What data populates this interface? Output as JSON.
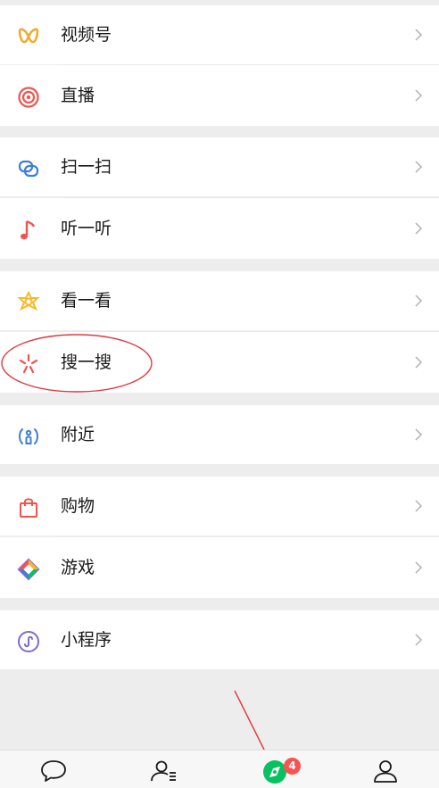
{
  "menu": {
    "channels": {
      "label": "视频号",
      "icon": "channels-icon"
    },
    "live": {
      "label": "直播",
      "icon": "live-icon"
    },
    "scan": {
      "label": "扫一扫",
      "icon": "scan-icon"
    },
    "shake_listen": {
      "label": "听一听",
      "icon": "music-note-icon"
    },
    "top_stories": {
      "label": "看一看",
      "icon": "top-stories-icon"
    },
    "search": {
      "label": "搜一搜",
      "icon": "search-sparkle-icon"
    },
    "nearby": {
      "label": "附近",
      "icon": "nearby-icon"
    },
    "shopping": {
      "label": "购物",
      "icon": "shopping-bag-icon"
    },
    "games": {
      "label": "游戏",
      "icon": "games-icon"
    },
    "mini_programs": {
      "label": "小程序",
      "icon": "mini-program-icon"
    }
  },
  "tabbar": {
    "chats_icon": "chat-bubble-icon",
    "contacts_icon": "contacts-icon",
    "discover_icon": "discover-icon",
    "discover_badge": "4",
    "me_icon": "person-icon"
  },
  "colors": {
    "accent_green": "#07c160",
    "badge_red": "#fa5151",
    "annotation_red": "#e0393e"
  }
}
